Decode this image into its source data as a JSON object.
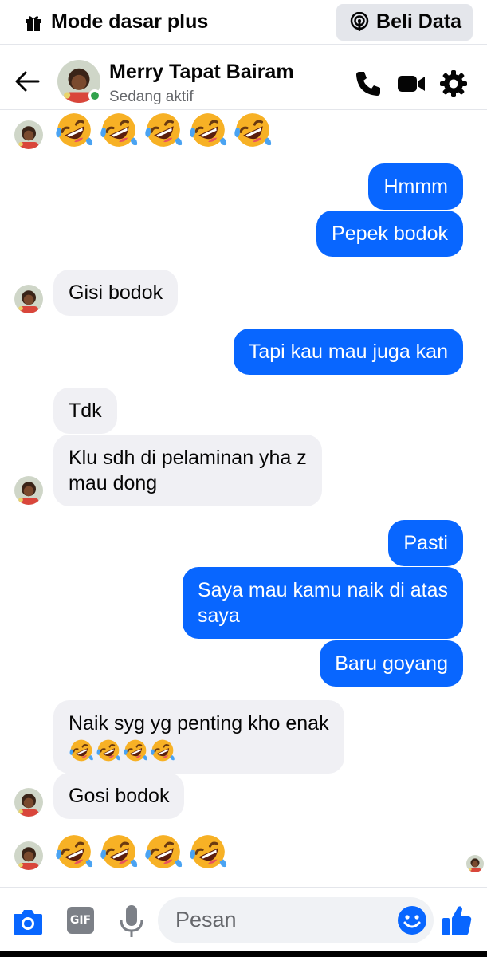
{
  "promo": {
    "left_label": "Mode dasar plus",
    "button_label": "Beli Data"
  },
  "header": {
    "contact_name": "Merry Tapat Bairam",
    "status": "Sedang aktif"
  },
  "messages": {
    "out_hmmm": "Hmmm",
    "out_pepek": "Pepek bodok",
    "in_gisi": "Gisi bodok",
    "out_tapi": "Tapi kau mau juga kan",
    "in_tdk": "Tdk",
    "in_klu_1": "Klu sdh di pelaminan yha z",
    "in_klu_2": "mau dong",
    "out_pasti": "Pasti",
    "out_saya_1": "Saya mau kamu naik di atas",
    "out_saya_2": "saya",
    "out_baru": "Baru goyang",
    "in_naik": "Naik syg yg penting kho enak",
    "in_gosi": "Gosi bodok"
  },
  "composer": {
    "placeholder": "Pesan",
    "gif_label": "GIF"
  },
  "colors": {
    "accent": "#0866ff",
    "incoming_bubble": "#f0f0f4",
    "online": "#31a24c",
    "emoji": "#f7b125"
  },
  "icons": [
    "gift-icon",
    "podcast-icon",
    "back-arrow-icon",
    "phone-icon",
    "video-icon",
    "gear-icon",
    "camera-icon",
    "gif-icon",
    "microphone-icon",
    "smiley-icon",
    "thumbs-up-icon",
    "rofl-emoji"
  ]
}
